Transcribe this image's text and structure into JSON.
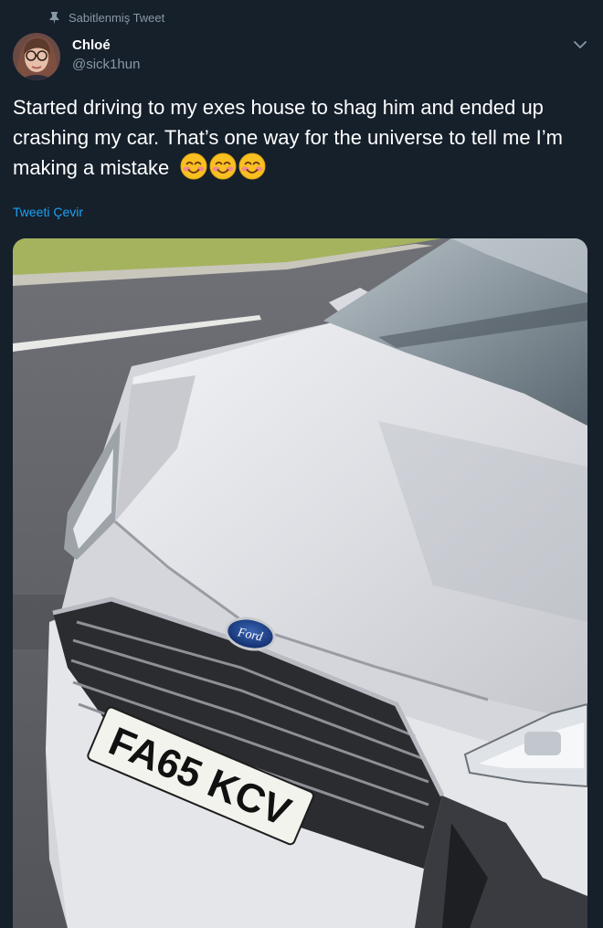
{
  "pinned": {
    "label": "Sabitlenmiş Tweet",
    "icon": "pin-icon"
  },
  "user": {
    "display_name": "Chloé",
    "handle": "@sick1hun"
  },
  "tweet": {
    "text": "Started driving to my exes house to shag him and ended up crashing my car. That’s one way for the universe to tell me I’m making a mistake",
    "emojis": [
      "smiling-face-emoji",
      "smiling-face-emoji",
      "smiling-face-emoji"
    ],
    "translate_label": "Tweeti Çevir"
  },
  "media": {
    "plate_text": "FA65 KCV",
    "badge_text": "Ford"
  },
  "colors": {
    "background": "#15202b",
    "secondary_text": "#8899a6",
    "link": "#1da1f2"
  }
}
